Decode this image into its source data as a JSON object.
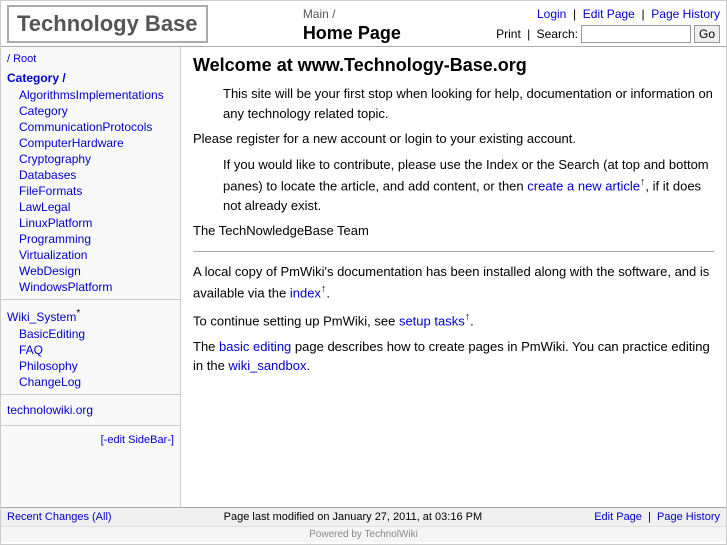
{
  "header": {
    "site_title": "Technology Base",
    "breadcrumb": "Main /",
    "page_heading": "Home Page",
    "login_label": "Login",
    "edit_page_label": "Edit Page",
    "page_history_label": "Page History",
    "print_label": "Print",
    "search_label": "Search:",
    "search_placeholder": "",
    "go_label": "Go"
  },
  "sidebar": {
    "root_label": "/ Root",
    "category_label": "Category /",
    "links": [
      "AlgorithmsImplementations",
      "Category",
      "CommunicationProtocols",
      "ComputerHardware",
      "Cryptography",
      "Databases",
      "FileFormats",
      "LawLegal",
      "LinuxPlatform",
      "Programming",
      "Virtualization",
      "WebDesign",
      "WindowsPlatform"
    ],
    "wiki_system_label": "Wiki_System",
    "wiki_system_sup": "*",
    "wiki_links": [
      "BasicEditing",
      "FAQ",
      "Philosophy",
      "ChangeLog"
    ],
    "technolo_label": "technolowiki.org",
    "edit_sidebar_label": "[-edit SideBar-]"
  },
  "main": {
    "heading": "Welcome at www.Technology-Base.org",
    "para1": "This site will be your first stop when looking for help, documentation or information on any technology related topic.",
    "para2": "Please register for a new account or login to your existing account.",
    "para3_pre": "If you would like to contribute, please use the Index or the Search (at top and bottom panes) to locate the article, and add content, or then ",
    "para3_link": "create a new article",
    "para3_link_sup": "↑",
    "para3_post": ", if it does not already exist.",
    "para4": "The TechNowledgeBase Team",
    "para5_pre": "A local copy of PmWiki's documentation has been installed along with the software, and is available via the ",
    "para5_link": "index",
    "para5_link_sup": "↑",
    "para5_post": ".",
    "para6_pre": "To continue setting up PmWiki, see ",
    "para6_link": "setup tasks",
    "para6_link_sup": "↑",
    "para6_post": ".",
    "para7_pre": "The ",
    "para7_link1": "basic editing",
    "para7_mid": " page describes how to create pages in PmWiki. You can practice editing in the ",
    "para7_link2": "wiki_sandbox",
    "para7_end": "."
  },
  "footer": {
    "recent_changes_label": "Recent Changes (All)",
    "modified_text": "Page last modified on January 27, 2011, at 03:16 PM",
    "edit_page_label": "Edit Page",
    "page_history_label": "Page History",
    "powered_text": "Powered by TechnolWiki"
  }
}
